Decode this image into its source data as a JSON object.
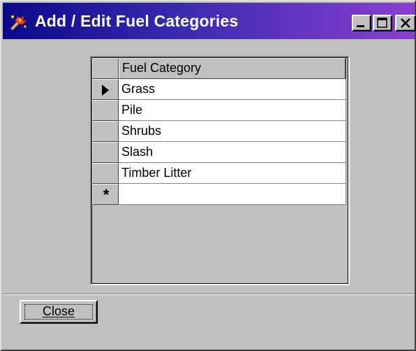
{
  "window": {
    "title": "Add / Edit Fuel Categories",
    "icon": "fire-spark-icon"
  },
  "grid": {
    "column_header": "Fuel Category",
    "current_row_index": 0,
    "rows": [
      {
        "value": "Grass"
      },
      {
        "value": "Pile"
      },
      {
        "value": "Shrubs"
      },
      {
        "value": "Slash"
      },
      {
        "value": "Timber Litter"
      }
    ],
    "new_row_marker": "*"
  },
  "buttons": {
    "close_label": "Close"
  },
  "colors": {
    "titlebar_start": "#0a0a8a",
    "titlebar_end": "#8a3fd0",
    "face": "#c0c0c0"
  }
}
